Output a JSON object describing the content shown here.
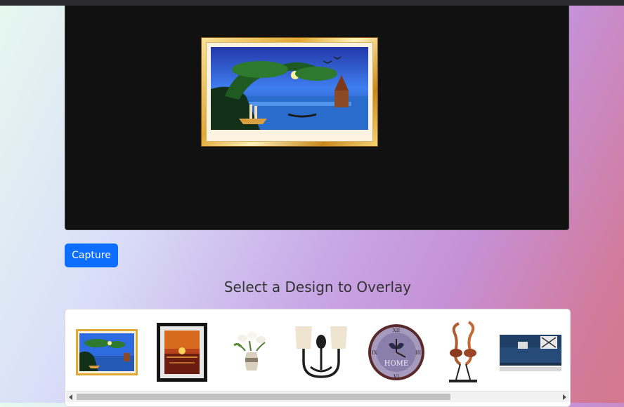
{
  "capture_button": {
    "label": "Capture"
  },
  "gallery": {
    "title": "Select a Design to Overlay",
    "items": [
      {
        "icon": "landscape-painting-icon"
      },
      {
        "icon": "sunset-painting-icon"
      },
      {
        "icon": "flower-vase-icon"
      },
      {
        "icon": "wall-sconce-icon"
      },
      {
        "icon": "wall-clock-icon",
        "text": "HOME"
      },
      {
        "icon": "flamingo-sculpture-icon"
      },
      {
        "icon": "sofa-icon"
      }
    ]
  }
}
